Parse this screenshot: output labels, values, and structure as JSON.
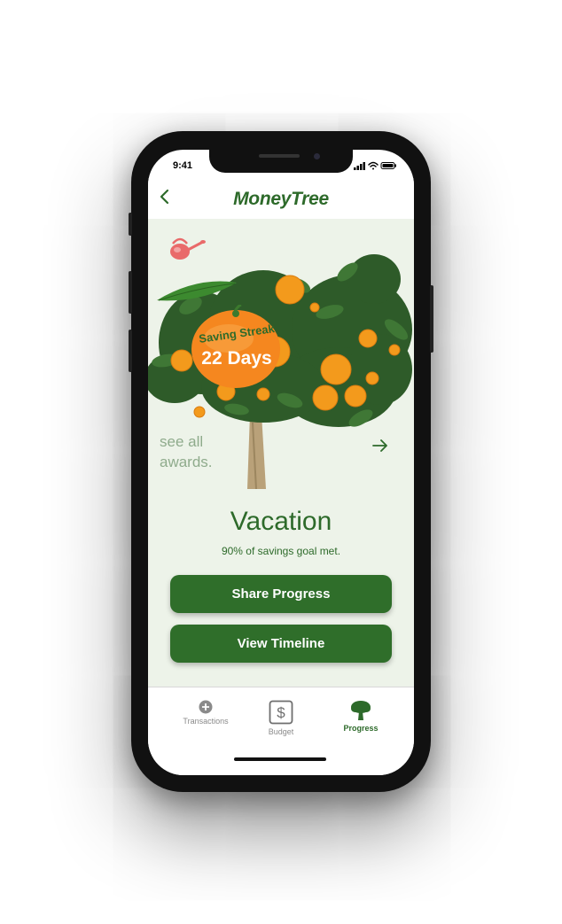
{
  "status_bar": {
    "time": "9:41"
  },
  "header": {
    "title": "MoneyTree"
  },
  "streak": {
    "label": "Saving Streak",
    "days": "22 Days"
  },
  "awards": {
    "line1": "see all",
    "line2": "awards."
  },
  "goal": {
    "name": "Vacation",
    "subtitle": "90% of savings goal met."
  },
  "actions": {
    "share_label": "Share Progress",
    "timeline_label": "View Timeline"
  },
  "tabs": [
    {
      "label": "Transactions",
      "icon": "plus-circle-icon",
      "active": false
    },
    {
      "label": "Budget",
      "icon": "dollar-box-icon",
      "active": false
    },
    {
      "label": "Progress",
      "icon": "tree-icon",
      "active": true
    }
  ],
  "colors": {
    "brand_green": "#2d6a2a",
    "button_green": "#2f6e2a",
    "content_bg": "#edf3e9",
    "muted_text": "#8fab8c",
    "orange": "#f5871f",
    "inactive_tab": "#8a8a8a"
  }
}
